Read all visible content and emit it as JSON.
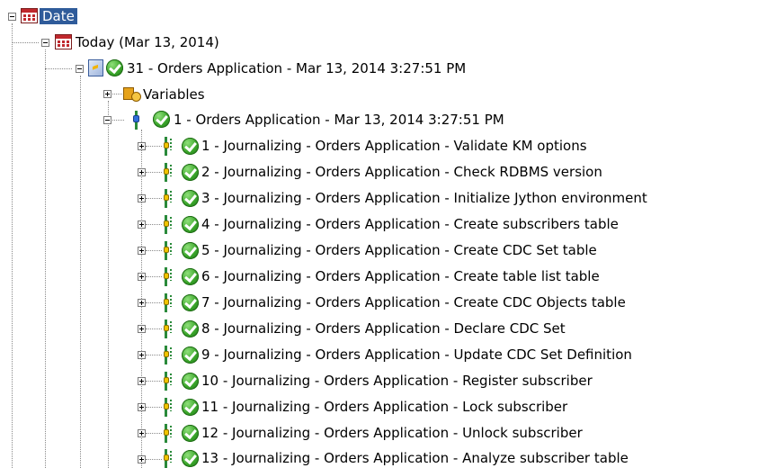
{
  "tree": {
    "root": {
      "label": "Date",
      "icon": "calendar-icon",
      "expanded": true,
      "selected": true
    },
    "day": {
      "label": "Today (Mar 13, 2014)",
      "icon": "calendar-icon",
      "expanded": true
    },
    "session": {
      "label": "31 - Orders Application - Mar 13, 2014 3:27:51 PM",
      "status_icon": "success-check-icon",
      "expanded": true
    },
    "variables": {
      "label": "Variables",
      "icon": "variables-icon",
      "expanded": false
    },
    "step": {
      "label": "1 - Orders Application - Mar 13, 2014 3:27:51 PM",
      "status_icon": "success-check-icon",
      "expanded": true
    },
    "tasks": [
      {
        "label": "1 - Journalizing - Orders Application - Validate KM options"
      },
      {
        "label": "2 - Journalizing - Orders Application - Check RDBMS version"
      },
      {
        "label": "3 - Journalizing - Orders Application - Initialize Jython environment"
      },
      {
        "label": "4 - Journalizing - Orders Application - Create subscribers table"
      },
      {
        "label": "5 - Journalizing - Orders Application - Create CDC Set table"
      },
      {
        "label": "6 - Journalizing - Orders Application - Create table list table"
      },
      {
        "label": "7 - Journalizing - Orders Application - Create CDC Objects table"
      },
      {
        "label": "8 - Journalizing - Orders Application - Declare CDC Set"
      },
      {
        "label": "9 - Journalizing - Orders Application - Update CDC Set Definition"
      },
      {
        "label": "10 - Journalizing - Orders Application - Register subscriber"
      },
      {
        "label": "11 - Journalizing - Orders Application - Lock subscriber"
      },
      {
        "label": "12 - Journalizing - Orders Application - Unlock subscriber"
      },
      {
        "label": "13 - Journalizing - Orders Application - Analyze subscriber table"
      }
    ]
  }
}
